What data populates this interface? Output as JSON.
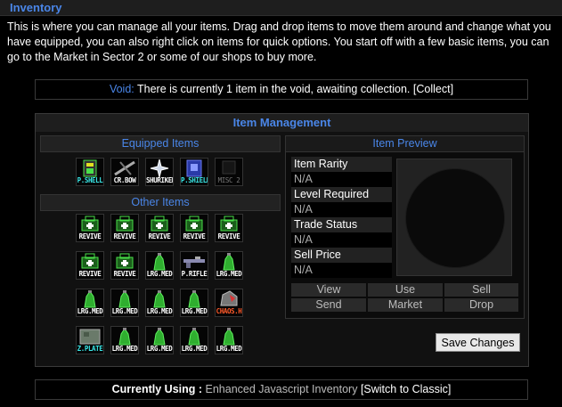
{
  "header": {
    "title": "Inventory"
  },
  "intro": "This is where you can manage all your items. Drag and drop items to move them around and change what you have equipped, you can also right click on items for quick options. You start off with a few basic items, you can go to the Market in Sector 2 or some of our shops to buy more.",
  "void": {
    "label": "Void:",
    "text": "There is currently 1 item in the void, awaiting collection.",
    "link": "[Collect]"
  },
  "management": {
    "title": "Item Management",
    "equipped_title": "Equipped Items",
    "equipped": [
      {
        "label": "P.SHELL",
        "icon": "shell-icon"
      },
      {
        "label": "CR.BOW",
        "icon": "crossbow-icon"
      },
      {
        "label": "SHURIKEN",
        "icon": "shuriken-icon"
      },
      {
        "label": "P.SHIELD",
        "icon": "shield-icon"
      },
      {
        "label": "MISC 2",
        "icon": "empty-slot-icon"
      }
    ],
    "other_title": "Other Items",
    "other": [
      {
        "label": "REVIVE",
        "icon": "revive-icon"
      },
      {
        "label": "REVIVE",
        "icon": "revive-icon"
      },
      {
        "label": "REVIVE",
        "icon": "revive-icon"
      },
      {
        "label": "REVIVE",
        "icon": "revive-icon"
      },
      {
        "label": "REVIVE",
        "icon": "revive-icon"
      },
      {
        "label": "REVIVE",
        "icon": "revive-icon"
      },
      {
        "label": "REVIVE",
        "icon": "revive-icon"
      },
      {
        "label": "LRG.MED",
        "icon": "medkit-icon"
      },
      {
        "label": "P.RIFLE",
        "icon": "rifle-icon"
      },
      {
        "label": "LRG.MED",
        "icon": "medkit-icon"
      },
      {
        "label": "LRG.MED",
        "icon": "medkit-icon"
      },
      {
        "label": "LRG.MED",
        "icon": "medkit-icon"
      },
      {
        "label": "LRG.MED",
        "icon": "medkit-icon"
      },
      {
        "label": "LRG.MED",
        "icon": "medkit-icon"
      },
      {
        "label": "CHAOS.H",
        "icon": "chaos-helmet-icon"
      },
      {
        "label": "Z.PLATE",
        "icon": "plate-icon"
      },
      {
        "label": "LRG.MED",
        "icon": "medkit-icon"
      },
      {
        "label": "LRG.MED",
        "icon": "medkit-icon"
      },
      {
        "label": "LRG.MED",
        "icon": "medkit-icon"
      },
      {
        "label": "LRG.MED",
        "icon": "medkit-icon"
      }
    ],
    "preview": {
      "title": "Item Preview",
      "props": [
        {
          "name": "Item Rarity",
          "value": "N/A"
        },
        {
          "name": "Level Required",
          "value": "N/A"
        },
        {
          "name": "Trade Status",
          "value": "N/A"
        },
        {
          "name": "Sell Price",
          "value": "N/A"
        }
      ],
      "actions": [
        "View",
        "Use",
        "Sell",
        "Send",
        "Market",
        "Drop"
      ]
    },
    "save_label": "Save Changes"
  },
  "footer": {
    "label": "Currently Using :",
    "mode": "Enhanced Javascript Inventory",
    "switch": "[Switch to Classic]"
  }
}
